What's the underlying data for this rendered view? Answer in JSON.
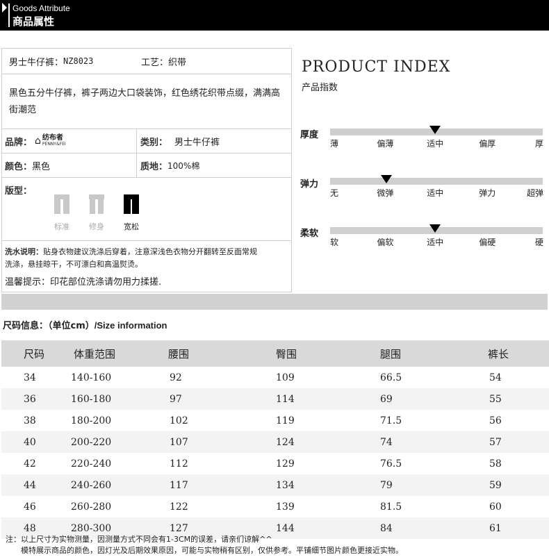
{
  "header": {
    "title_en": "Goods Attribute",
    "title_cn": "商品属性"
  },
  "attributes": {
    "name_label": "男士牛仔裤：",
    "name_value": "NZ8023",
    "craft_label": "工艺：",
    "craft_value": "织带",
    "description": "黑色五分牛仔裤，裤子两边大口袋装饰，红色绣花织带点缀，满满高街潮范",
    "brand_label": "品牌：",
    "brand_name": "纺布者",
    "brand_sub": "PENNY&FEI",
    "category_label": "类别：",
    "category_value": "男士牛仔裤",
    "color_label": "颜色：",
    "color_value": "黑色",
    "material_label": "质地：",
    "material_value": "100%棉",
    "fit_label": "版型：",
    "fit_options": [
      {
        "label": "标准",
        "active": false
      },
      {
        "label": "修身",
        "active": false
      },
      {
        "label": "宽松",
        "active": true
      }
    ],
    "wash_label": "洗水说明：",
    "wash_text_1": "贴身衣物建议洗涤后穿着，注意深浅色衣物分开翻转至反面常规",
    "wash_text_2": "洗涤，悬挂晾干，不可漂白和高温熨烫。",
    "tip": "温馨提示：印花部位洗涤请勿用力揉搓."
  },
  "product_index": {
    "title": "PRODUCT INDEX",
    "subtitle": "产品指数",
    "scales": [
      {
        "label": "厚度",
        "ticks": [
          "薄",
          "偏薄",
          "适中",
          "偏厚",
          "厚"
        ],
        "value_index": 2
      },
      {
        "label": "弹力",
        "ticks": [
          "无",
          "微弹",
          "适中",
          "弹力",
          "超弹"
        ],
        "value_index": 1
      },
      {
        "label": "柔软",
        "ticks": [
          "软",
          "偏软",
          "适中",
          "偏硬",
          "硬"
        ],
        "value_index": 2
      }
    ]
  },
  "size_info": {
    "title_cn": "尺码信息：（单位cm）",
    "title_en": "/Size information",
    "headers": [
      "尺码",
      "体重范围",
      "腰围",
      "臀围",
      "腿围",
      "裤长"
    ],
    "rows": [
      [
        "34",
        "140-160",
        "92",
        "109",
        "66.5",
        "54"
      ],
      [
        "36",
        "160-180",
        "97",
        "114",
        "69",
        "55"
      ],
      [
        "38",
        "180-200",
        "102",
        "119",
        "71.5",
        "56"
      ],
      [
        "40",
        "200-220",
        "107",
        "124",
        "74",
        "57"
      ],
      [
        "42",
        "220-240",
        "112",
        "129",
        "76.5",
        "58"
      ],
      [
        "44",
        "240-260",
        "117",
        "134",
        "79",
        "59"
      ],
      [
        "46",
        "260-280",
        "122",
        "139",
        "81.5",
        "60"
      ],
      [
        "48",
        "280-300",
        "127",
        "144",
        "84",
        "61"
      ]
    ]
  },
  "notes": {
    "line1": "注：以上尺寸为实物测量，因测量方式不同会有1-3CM的误差，请亲们谅解^^",
    "line2": "模特展示商品的颜色，因灯光及后期效果原因，可能与实物稍有区别，仅供参考。平铺细节图片颜色更接近实物。"
  },
  "colors": {
    "header_bg": "#000000",
    "track": "#cfcfcf",
    "table_header": "#d9d9d9"
  }
}
